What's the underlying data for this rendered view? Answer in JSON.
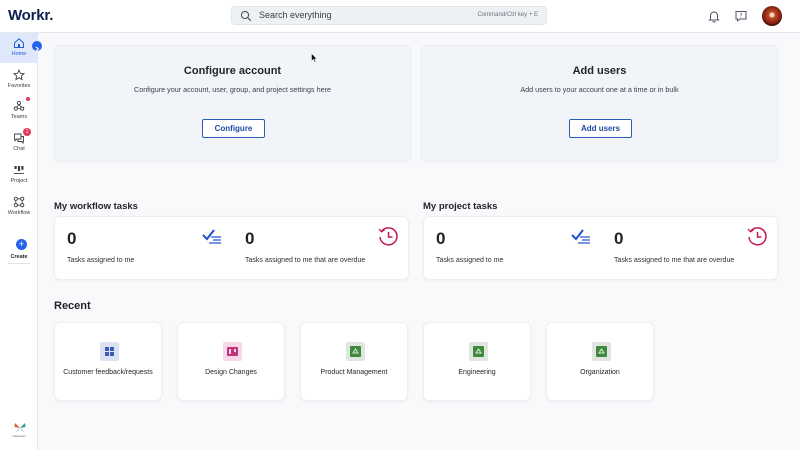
{
  "app": {
    "logo": "Workr."
  },
  "search": {
    "placeholder": "Search everything",
    "shortcut": "Command/Ctrl key + E"
  },
  "header_icons": [
    "bell-icon",
    "help-chat-icon"
  ],
  "sidebar": {
    "items": [
      {
        "label": "Home",
        "icon": "home-icon",
        "active": true
      },
      {
        "label": "Favorites",
        "icon": "star-icon"
      },
      {
        "label": "Teams",
        "icon": "teams-icon",
        "dot_badge": true
      },
      {
        "label": "Chat",
        "icon": "chat-icon",
        "badge": "1"
      },
      {
        "label": "Project",
        "icon": "project-icon"
      },
      {
        "label": "Workflow",
        "icon": "workflow-icon"
      }
    ],
    "create_label": "Create",
    "brand_caption": "CapLearn"
  },
  "setup_cards": [
    {
      "title": "Configure account",
      "description": "Configure your account, user, group, and project settings here",
      "button": "Configure"
    },
    {
      "title": "Add users",
      "description": "Add users to your account one at a time or in bulk",
      "button": "Add users"
    }
  ],
  "workflow_tasks": {
    "title": "My workflow tasks",
    "assigned": {
      "value": "0",
      "label": "Tasks assigned to me"
    },
    "overdue": {
      "value": "0",
      "label": "Tasks assigned to me that are overdue"
    }
  },
  "project_tasks": {
    "title": "My project tasks",
    "assigned": {
      "value": "0",
      "label": "Tasks assigned to me"
    },
    "overdue": {
      "value": "0",
      "label": "Tasks assigned to me that are overdue"
    }
  },
  "recent": {
    "title": "Recent",
    "items": [
      {
        "label": "Customer feedback/requests",
        "icon": "grid-app-icon",
        "color": "#3b5bb5",
        "bg": "#dbe2f4"
      },
      {
        "label": "Design Changes",
        "icon": "kanban-app-icon",
        "color": "#c2337a",
        "bg": "#f6d8e8"
      },
      {
        "label": "Product Management",
        "icon": "recycle-app-icon",
        "color": "#3f8a3b",
        "bg": "#dfe6df"
      },
      {
        "label": "Engineering",
        "icon": "recycle-app-icon",
        "color": "#3f8a3b",
        "bg": "#dfe6df"
      },
      {
        "label": "Organization",
        "icon": "recycle-app-icon",
        "color": "#3f8a3b",
        "bg": "#dfe6df"
      }
    ]
  },
  "colors": {
    "accent": "#2563eb",
    "button_border": "#2f5bb8",
    "overdue_icon": "#c2185b",
    "badge": "#e23b5b"
  }
}
